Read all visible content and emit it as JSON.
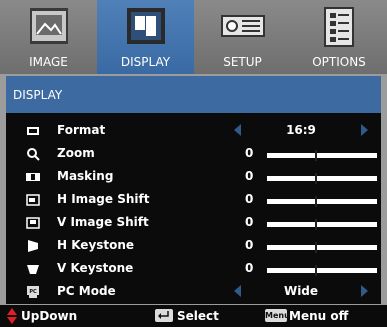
{
  "tabs": [
    {
      "label": "IMAGE",
      "icon": "image-icon",
      "active": false
    },
    {
      "label": "DISPLAY",
      "icon": "display-icon",
      "active": true
    },
    {
      "label": "SETUP",
      "icon": "setup-icon",
      "active": false
    },
    {
      "label": "OPTIONS",
      "icon": "options-icon",
      "active": false
    }
  ],
  "panel": {
    "title": "DISPLAY"
  },
  "rows": [
    {
      "label": "Format",
      "icon": "format-icon",
      "value": "16:9",
      "type": "select"
    },
    {
      "label": "Zoom",
      "icon": "zoom-icon",
      "value": "0",
      "type": "slider"
    },
    {
      "label": "Masking",
      "icon": "masking-icon",
      "value": "0",
      "type": "slider"
    },
    {
      "label": "H Image Shift",
      "icon": "h-image-shift-icon",
      "value": "0",
      "type": "slider"
    },
    {
      "label": "V Image Shift",
      "icon": "v-image-shift-icon",
      "value": "0",
      "type": "slider"
    },
    {
      "label": "H Keystone",
      "icon": "h-keystone-icon",
      "value": "0",
      "type": "slider"
    },
    {
      "label": "V Keystone",
      "icon": "v-keystone-icon",
      "value": "0",
      "type": "slider"
    },
    {
      "label": "PC Mode",
      "icon": "pc-mode-icon",
      "value": "Wide",
      "type": "select"
    }
  ],
  "footer": {
    "updown": "UpDown",
    "select": "Select",
    "menu_key": "Menu",
    "menu_off": "Menu off"
  },
  "colors": {
    "accent": "#3d6aa0",
    "panel": "#0b0b0b",
    "arrow": "#2f5a8a",
    "updown": "#e02020"
  }
}
